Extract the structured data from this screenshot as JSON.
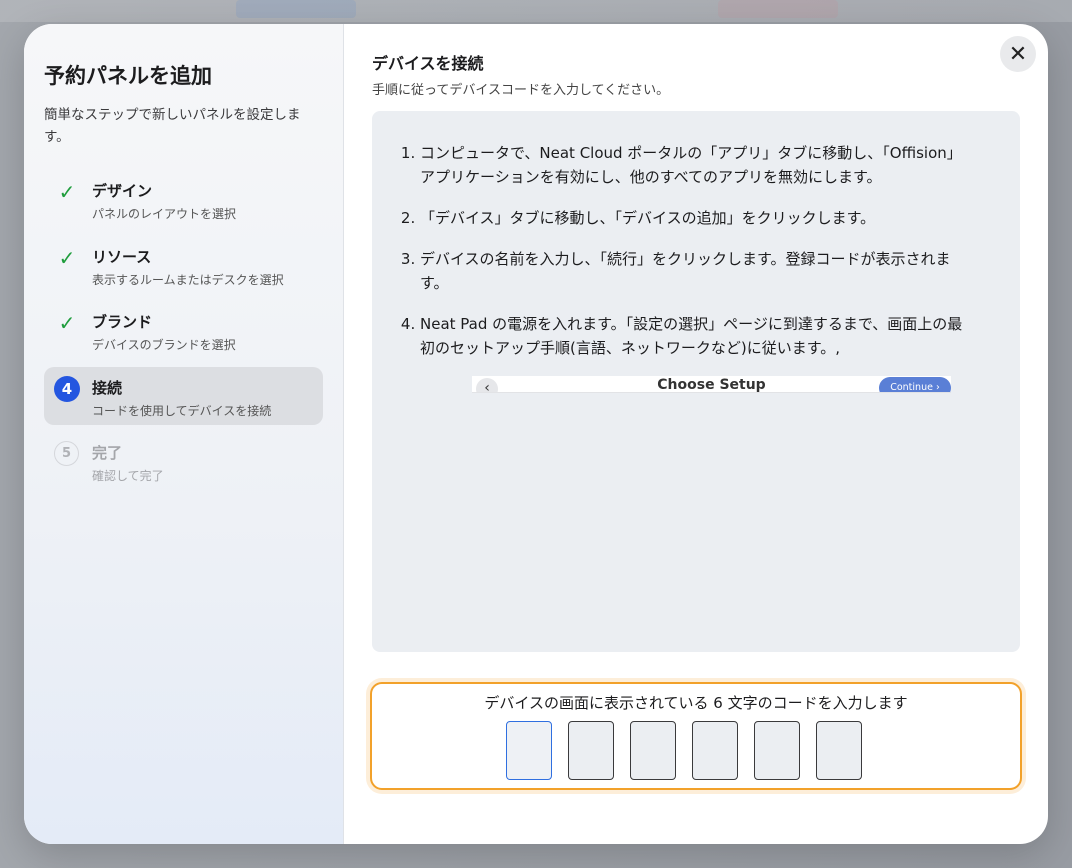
{
  "sidebar": {
    "title": "予約パネルを追加",
    "subtitle": "簡単なステップで新しいパネルを設定します。",
    "steps": [
      {
        "marker": "✓",
        "label": "デザイン",
        "desc": "パネルのレイアウトを選択",
        "state": "done"
      },
      {
        "marker": "✓",
        "label": "リソース",
        "desc": "表示するルームまたはデスクを選択",
        "state": "done"
      },
      {
        "marker": "✓",
        "label": "ブランド",
        "desc": "デバイスのブランドを選択",
        "state": "done"
      },
      {
        "marker": "4",
        "label": "接続",
        "desc": "コードを使用してデバイスを接続",
        "state": "active"
      },
      {
        "marker": "5",
        "label": "完了",
        "desc": "確認して完了",
        "state": "pending"
      }
    ]
  },
  "main": {
    "title": "デバイスを接続",
    "subtitle": "手順に従ってデバイスコードを入力してください。",
    "close_icon": "✕",
    "instructions": [
      "コンピュータで、Neat Cloud ポータルの「アプリ」タブに移動し、「Offision」アプリケーションを有効にし、他のすべてのアプリを無効にします。",
      "「デバイス」タブに移動し、「デバイスの追加」をクリックします。",
      "デバイスの名前を入力し、「続行」をクリックします。登録コードが表示されます。",
      "Neat Pad の電源を入れます。「設定の選択」ページに到達するまで、画面上の最初のセットアップ手順(言語、ネットワークなど)に従います。,"
    ],
    "setup_preview": {
      "back_icon": "‹",
      "title": "Choose Setup",
      "continue_label": "Continue ›"
    },
    "code_entry": {
      "prompt": "デバイスの画面に表示されている 6 文字のコードを入力します",
      "digits": [
        "",
        "",
        "",
        "",
        "",
        ""
      ]
    }
  },
  "colors": {
    "accent": "#2456e0",
    "check": "#1f9d3d",
    "highlight_border": "#f2a12a"
  }
}
